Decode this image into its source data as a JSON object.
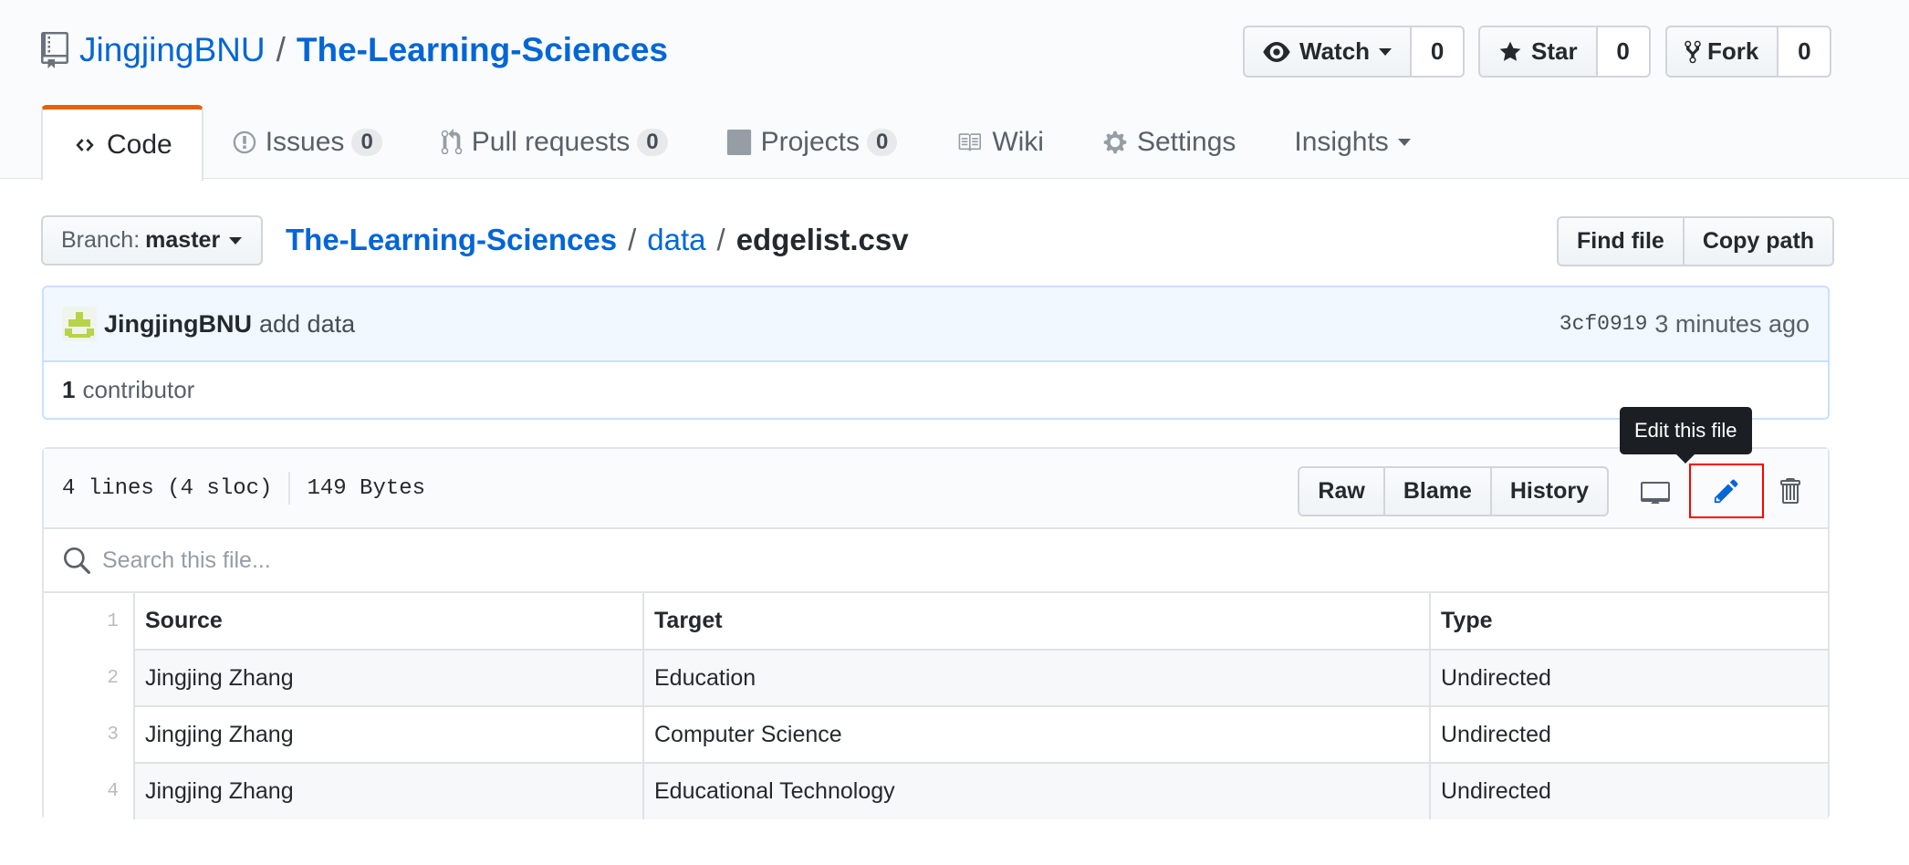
{
  "repo": {
    "owner": "JingjingBNU",
    "separator": "/",
    "name": "The-Learning-Sciences"
  },
  "social": {
    "watch": {
      "label": "Watch",
      "count": "0"
    },
    "star": {
      "label": "Star",
      "count": "0"
    },
    "fork": {
      "label": "Fork",
      "count": "0"
    }
  },
  "tabs": {
    "code": {
      "label": "Code"
    },
    "issues": {
      "label": "Issues",
      "count": "0"
    },
    "pulls": {
      "label": "Pull requests",
      "count": "0"
    },
    "projects": {
      "label": "Projects",
      "count": "0"
    },
    "wiki": {
      "label": "Wiki"
    },
    "settings": {
      "label": "Settings"
    },
    "insights": {
      "label": "Insights"
    }
  },
  "branch": {
    "label": "Branch:",
    "value": "master"
  },
  "breadcrumb": {
    "repo": "The-Learning-Sciences",
    "sep": "/",
    "folder": "data",
    "file": "edgelist.csv"
  },
  "file_nav": {
    "find_file": "Find file",
    "copy_path": "Copy path"
  },
  "commit": {
    "author": "JingjingBNU",
    "message": "add data",
    "sha": "3cf0919",
    "time": "3 minutes ago"
  },
  "contributors": {
    "count": "1",
    "label": "contributor"
  },
  "file_info": {
    "lines": "4 lines (4 sloc)",
    "size": "149 Bytes"
  },
  "file_actions": {
    "raw": "Raw",
    "blame": "Blame",
    "history": "History",
    "tooltip": "Edit this file"
  },
  "search": {
    "placeholder": "Search this file..."
  },
  "csv": {
    "header": {
      "num": "1",
      "cells": [
        "Source",
        "Target",
        "Type"
      ]
    },
    "rows": [
      {
        "num": "2",
        "cells": [
          "Jingjing Zhang",
          "Education",
          "Undirected"
        ]
      },
      {
        "num": "3",
        "cells": [
          "Jingjing Zhang",
          "Computer Science",
          "Undirected"
        ]
      },
      {
        "num": "4",
        "cells": [
          "Jingjing Zhang",
          "Educational Technology",
          "Undirected"
        ]
      }
    ]
  },
  "colors": {
    "link": "#0366d6",
    "tab_accent": "#e36209",
    "highlight_box": "#ff0000",
    "tooltip_bg": "#1b1f23"
  }
}
